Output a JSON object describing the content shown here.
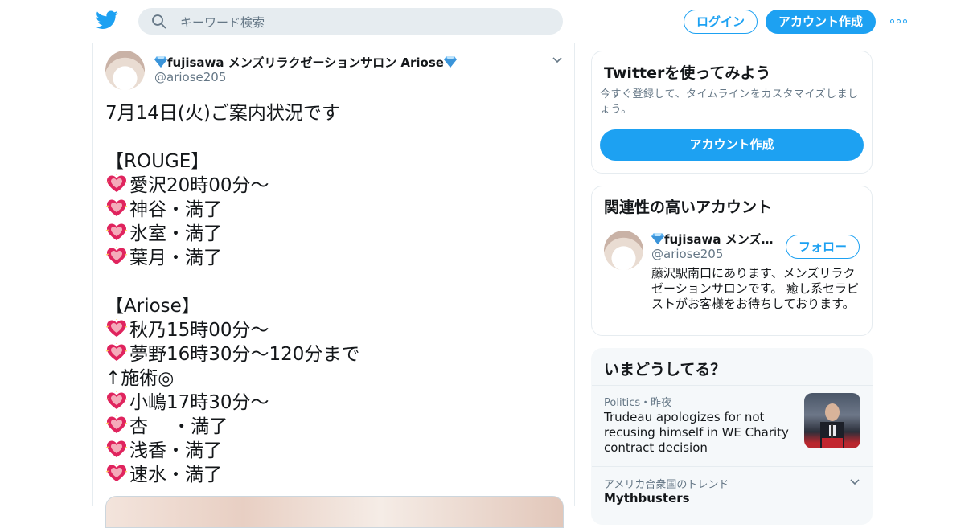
{
  "header": {
    "search_placeholder": "キーワード検索",
    "login_label": "ログイン",
    "signup_label": "アカウント作成"
  },
  "tweet": {
    "display_name": "fujisawa メンズリラクゼーションサロン Ariose",
    "handle": "@ariose205",
    "lines": [
      {
        "text": "7月14日(火)ご案内状況です",
        "heart": false
      },
      {
        "text": "",
        "heart": false
      },
      {
        "text": "【ROUGE】",
        "heart": false
      },
      {
        "text": "愛沢20時00分～",
        "heart": true
      },
      {
        "text": "神谷・満了",
        "heart": true
      },
      {
        "text": "氷室・満了",
        "heart": true
      },
      {
        "text": "葉月・満了",
        "heart": true
      },
      {
        "text": "",
        "heart": false
      },
      {
        "text": "【Ariose】",
        "heart": false
      },
      {
        "text": "秋乃15時00分～",
        "heart": true
      },
      {
        "text": "夢野16時30分～120分まで",
        "heart": true
      },
      {
        "text": "↑施術◎",
        "heart": false
      },
      {
        "text": "小嶋17時30分～",
        "heart": true
      },
      {
        "text": "杏　 ・満了",
        "heart": true
      },
      {
        "text": "浅香・満了",
        "heart": true
      },
      {
        "text": "速水・満了",
        "heart": true
      }
    ]
  },
  "sidebar": {
    "signup_card": {
      "title": "Twitterを使ってみよう",
      "description": "今すぐ登録して、タイムラインをカスタマイズしましょう。",
      "button_label": "アカウント作成"
    },
    "related_card": {
      "title": "関連性の高いアカウント",
      "name": "fujisawa メンズリ...",
      "handle": "@ariose205",
      "follow_label": "フォロー",
      "bio": "藤沢駅南口にあります、メンズリラクゼーションサロンです。 癒し系セラピストがお客様をお待ちしております。"
    },
    "trends_card": {
      "title": "いまどうしてる？",
      "trends": [
        {
          "meta": "Politics・昨夜",
          "title": "Trudeau apologizes for not recusing himself in WE Charity contract decision"
        },
        {
          "meta": "アメリカ合衆国のトレンド",
          "title": "Mythbusters"
        }
      ]
    }
  },
  "colors": {
    "accent": "#1da1f2",
    "heart": "#e0245e",
    "gem": "#55acee"
  }
}
